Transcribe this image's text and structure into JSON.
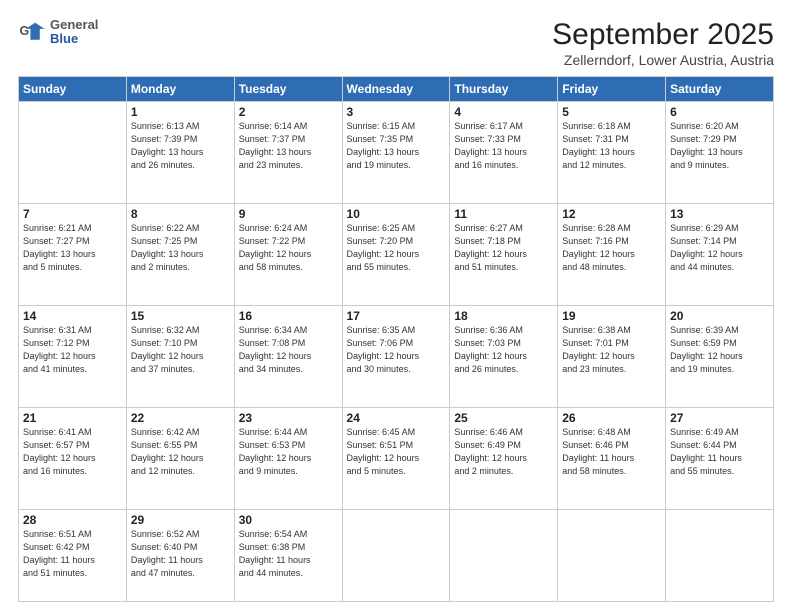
{
  "header": {
    "logo": {
      "general": "General",
      "blue": "Blue"
    },
    "title": "September 2025",
    "location": "Zellerndorf, Lower Austria, Austria"
  },
  "weekdays": [
    "Sunday",
    "Monday",
    "Tuesday",
    "Wednesday",
    "Thursday",
    "Friday",
    "Saturday"
  ],
  "weeks": [
    [
      {
        "day": "",
        "detail": ""
      },
      {
        "day": "1",
        "detail": "Sunrise: 6:13 AM\nSunset: 7:39 PM\nDaylight: 13 hours\nand 26 minutes."
      },
      {
        "day": "2",
        "detail": "Sunrise: 6:14 AM\nSunset: 7:37 PM\nDaylight: 13 hours\nand 23 minutes."
      },
      {
        "day": "3",
        "detail": "Sunrise: 6:15 AM\nSunset: 7:35 PM\nDaylight: 13 hours\nand 19 minutes."
      },
      {
        "day": "4",
        "detail": "Sunrise: 6:17 AM\nSunset: 7:33 PM\nDaylight: 13 hours\nand 16 minutes."
      },
      {
        "day": "5",
        "detail": "Sunrise: 6:18 AM\nSunset: 7:31 PM\nDaylight: 13 hours\nand 12 minutes."
      },
      {
        "day": "6",
        "detail": "Sunrise: 6:20 AM\nSunset: 7:29 PM\nDaylight: 13 hours\nand 9 minutes."
      }
    ],
    [
      {
        "day": "7",
        "detail": "Sunrise: 6:21 AM\nSunset: 7:27 PM\nDaylight: 13 hours\nand 5 minutes."
      },
      {
        "day": "8",
        "detail": "Sunrise: 6:22 AM\nSunset: 7:25 PM\nDaylight: 13 hours\nand 2 minutes."
      },
      {
        "day": "9",
        "detail": "Sunrise: 6:24 AM\nSunset: 7:22 PM\nDaylight: 12 hours\nand 58 minutes."
      },
      {
        "day": "10",
        "detail": "Sunrise: 6:25 AM\nSunset: 7:20 PM\nDaylight: 12 hours\nand 55 minutes."
      },
      {
        "day": "11",
        "detail": "Sunrise: 6:27 AM\nSunset: 7:18 PM\nDaylight: 12 hours\nand 51 minutes."
      },
      {
        "day": "12",
        "detail": "Sunrise: 6:28 AM\nSunset: 7:16 PM\nDaylight: 12 hours\nand 48 minutes."
      },
      {
        "day": "13",
        "detail": "Sunrise: 6:29 AM\nSunset: 7:14 PM\nDaylight: 12 hours\nand 44 minutes."
      }
    ],
    [
      {
        "day": "14",
        "detail": "Sunrise: 6:31 AM\nSunset: 7:12 PM\nDaylight: 12 hours\nand 41 minutes."
      },
      {
        "day": "15",
        "detail": "Sunrise: 6:32 AM\nSunset: 7:10 PM\nDaylight: 12 hours\nand 37 minutes."
      },
      {
        "day": "16",
        "detail": "Sunrise: 6:34 AM\nSunset: 7:08 PM\nDaylight: 12 hours\nand 34 minutes."
      },
      {
        "day": "17",
        "detail": "Sunrise: 6:35 AM\nSunset: 7:06 PM\nDaylight: 12 hours\nand 30 minutes."
      },
      {
        "day": "18",
        "detail": "Sunrise: 6:36 AM\nSunset: 7:03 PM\nDaylight: 12 hours\nand 26 minutes."
      },
      {
        "day": "19",
        "detail": "Sunrise: 6:38 AM\nSunset: 7:01 PM\nDaylight: 12 hours\nand 23 minutes."
      },
      {
        "day": "20",
        "detail": "Sunrise: 6:39 AM\nSunset: 6:59 PM\nDaylight: 12 hours\nand 19 minutes."
      }
    ],
    [
      {
        "day": "21",
        "detail": "Sunrise: 6:41 AM\nSunset: 6:57 PM\nDaylight: 12 hours\nand 16 minutes."
      },
      {
        "day": "22",
        "detail": "Sunrise: 6:42 AM\nSunset: 6:55 PM\nDaylight: 12 hours\nand 12 minutes."
      },
      {
        "day": "23",
        "detail": "Sunrise: 6:44 AM\nSunset: 6:53 PM\nDaylight: 12 hours\nand 9 minutes."
      },
      {
        "day": "24",
        "detail": "Sunrise: 6:45 AM\nSunset: 6:51 PM\nDaylight: 12 hours\nand 5 minutes."
      },
      {
        "day": "25",
        "detail": "Sunrise: 6:46 AM\nSunset: 6:49 PM\nDaylight: 12 hours\nand 2 minutes."
      },
      {
        "day": "26",
        "detail": "Sunrise: 6:48 AM\nSunset: 6:46 PM\nDaylight: 11 hours\nand 58 minutes."
      },
      {
        "day": "27",
        "detail": "Sunrise: 6:49 AM\nSunset: 6:44 PM\nDaylight: 11 hours\nand 55 minutes."
      }
    ],
    [
      {
        "day": "28",
        "detail": "Sunrise: 6:51 AM\nSunset: 6:42 PM\nDaylight: 11 hours\nand 51 minutes."
      },
      {
        "day": "29",
        "detail": "Sunrise: 6:52 AM\nSunset: 6:40 PM\nDaylight: 11 hours\nand 47 minutes."
      },
      {
        "day": "30",
        "detail": "Sunrise: 6:54 AM\nSunset: 6:38 PM\nDaylight: 11 hours\nand 44 minutes."
      },
      {
        "day": "",
        "detail": ""
      },
      {
        "day": "",
        "detail": ""
      },
      {
        "day": "",
        "detail": ""
      },
      {
        "day": "",
        "detail": ""
      }
    ]
  ]
}
